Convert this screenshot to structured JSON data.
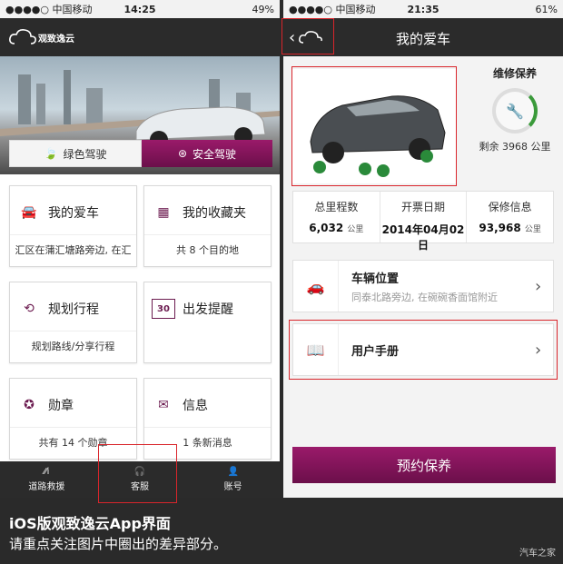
{
  "left": {
    "status": {
      "carrier": "●●●●○ 中国移动",
      "time": "14:25",
      "right": "49%"
    },
    "logo": "观致逸云",
    "modes": [
      {
        "label": "绿色驾驶"
      },
      {
        "label": "安全驾驶"
      }
    ],
    "cards": [
      {
        "title": "我的爱车",
        "sub": "汇区在蒲汇塘路旁边, 在汇",
        "icon": "car-icon"
      },
      {
        "title": "我的收藏夹",
        "sub": "共 8 个目的地",
        "icon": "favorites-icon"
      },
      {
        "title": "规划行程",
        "sub": "规划路线/分享行程",
        "icon": "route-icon"
      },
      {
        "title": "出发提醒",
        "sub": "",
        "icon": "calendar-icon",
        "badge": "30"
      },
      {
        "title": "勋章",
        "sub": "共有 14 个勋章",
        "icon": "medal-icon"
      },
      {
        "title": "信息",
        "sub": "1 条新消息",
        "icon": "mail-icon"
      }
    ],
    "tabs": [
      {
        "label": "道路救援"
      },
      {
        "label": "客服"
      },
      {
        "label": "账号"
      }
    ]
  },
  "right": {
    "status": {
      "carrier": "●●●●○ 中国移动",
      "time": "21:35",
      "right": "61%"
    },
    "title": "我的爱车",
    "maintenance": {
      "label": "维修保养",
      "remaining": "剩余 3968 公里"
    },
    "stats": [
      {
        "head": "总里程数",
        "value": "6,032",
        "unit": "公里"
      },
      {
        "head": "开票日期",
        "value": "2014年04月02日",
        "unit": ""
      },
      {
        "head": "保修信息",
        "value": "93,968",
        "unit": "公里"
      }
    ],
    "location": {
      "title": "车辆位置",
      "sub": "同泰北路旁边, 在碗碗香面馆附近"
    },
    "manual": {
      "title": "用户手册"
    },
    "book_button": "预约保养"
  },
  "caption": {
    "line1": "iOS版观致逸云App界面",
    "line2": "请重点关注图片中圈出的差异部分。"
  },
  "watermark": "汽车之家",
  "colors": {
    "accent": "#6b0f4a",
    "highlight": "#d9252b",
    "header": "#2b2b2b"
  }
}
